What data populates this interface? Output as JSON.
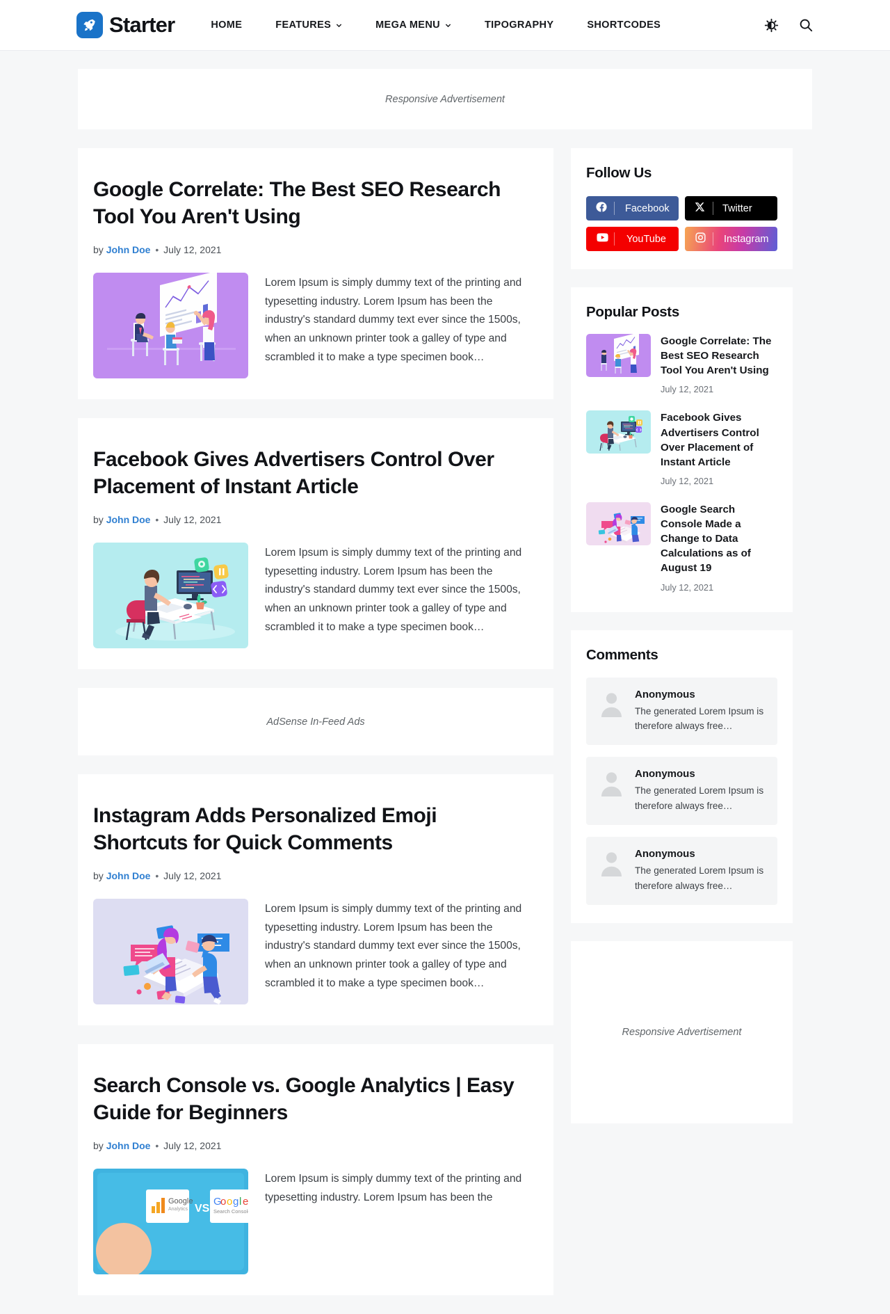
{
  "header": {
    "brand": "Starter",
    "logo_icon": "rocket-icon",
    "nav": [
      {
        "label": "HOME",
        "has_caret": false
      },
      {
        "label": "FEATURES",
        "has_caret": true
      },
      {
        "label": "MEGA MENU",
        "has_caret": true
      },
      {
        "label": "TIPOGRAPHY",
        "has_caret": false
      },
      {
        "label": "SHORTCODES",
        "has_caret": false
      }
    ],
    "actions": [
      {
        "icon": "dark-mode-toggle-icon",
        "name": "dark-mode-toggle"
      },
      {
        "icon": "search-icon",
        "name": "search-button"
      }
    ]
  },
  "ads": {
    "top": "Responsive Advertisement",
    "infeed": "AdSense In-Feed Ads",
    "sidebar": "Responsive Advertisement"
  },
  "posts": [
    {
      "title": "Google Correlate: The Best SEO Research Tool You Aren't Using",
      "by": "by",
      "author": "John Doe",
      "separator": "•",
      "date": "July 12, 2021",
      "excerpt": "Lorem Ipsum is simply dummy text of the printing and typesetting industry. Lorem Ipsum has been the industry's standard dummy text ever since the 1500s, when an unknown printer took a galley of type and scrambled it to make a type specimen book…",
      "image": "seo-presentation-illustration"
    },
    {
      "title": "Facebook Gives Advertisers Control Over Placement of Instant Article",
      "by": "by",
      "author": "John Doe",
      "separator": "•",
      "date": "July 12, 2021",
      "excerpt": "Lorem Ipsum is simply dummy text of the printing and typesetting industry. Lorem Ipsum has been the industry's standard dummy text ever since the 1500s, when an unknown printer took a galley of type and scrambled it to make a type specimen book…",
      "image": "developer-desk-illustration"
    },
    {
      "title": "Instagram Adds Personalized Emoji Shortcuts for Quick Comments",
      "by": "by",
      "author": "John Doe",
      "separator": "•",
      "date": "July 12, 2021",
      "excerpt": "Lorem Ipsum is simply dummy text of the printing and typesetting industry. Lorem Ipsum has been the industry's standard dummy text ever since the 1500s, when an unknown printer took a galley of type and scrambled it to make a type specimen book…",
      "image": "social-comments-illustration"
    },
    {
      "title": "Search Console vs. Google Analytics | Easy Guide for Beginners",
      "by": "by",
      "author": "John Doe",
      "separator": "•",
      "date": "July 12, 2021",
      "excerpt": "Lorem Ipsum is simply dummy text of the printing and typesetting industry. Lorem Ipsum has been the",
      "image": "analytics-vs-search-console-thumbnail",
      "image_labels": {
        "left": "Google Analytics",
        "vs": "VS",
        "right": "Google Search Console"
      }
    }
  ],
  "sidebar": {
    "follow": {
      "title": "Follow Us",
      "items": [
        {
          "label": "Facebook",
          "icon": "facebook-icon",
          "color": "#3d5a98"
        },
        {
          "label": "Twitter",
          "icon": "x-twitter-icon",
          "color": "#000000"
        },
        {
          "label": "YouTube",
          "icon": "youtube-icon",
          "color": "#f40000"
        },
        {
          "label": "Instagram",
          "icon": "instagram-icon",
          "color": "#e9447a"
        }
      ]
    },
    "popular": {
      "title": "Popular Posts",
      "items": [
        {
          "title": "Google Correlate: The Best SEO Research Tool You Aren't Using",
          "date": "July 12, 2021",
          "image": "seo-presentation-illustration"
        },
        {
          "title": "Facebook Gives Advertisers Control Over Placement of Instant Article",
          "date": "July 12, 2021",
          "image": "developer-desk-illustration"
        },
        {
          "title": "Google Search Console Made a Change to Data Calculations as of August 19",
          "date": "July 12, 2021",
          "image": "social-comments-illustration"
        }
      ]
    },
    "comments": {
      "title": "Comments",
      "items": [
        {
          "name": "Anonymous",
          "text": "The generated Lorem Ipsum is therefore always free…",
          "avatar": "anonymous-avatar-icon"
        },
        {
          "name": "Anonymous",
          "text": "The generated Lorem Ipsum is therefore always free…",
          "avatar": "anonymous-avatar-icon"
        },
        {
          "name": "Anonymous",
          "text": "The generated Lorem Ipsum is therefore always free…",
          "avatar": "anonymous-avatar-icon"
        }
      ]
    }
  },
  "colors": {
    "accent": "#2f7fd1",
    "page_bg": "#f6f7f8",
    "card_bg": "#ffffff",
    "text": "#111317"
  }
}
